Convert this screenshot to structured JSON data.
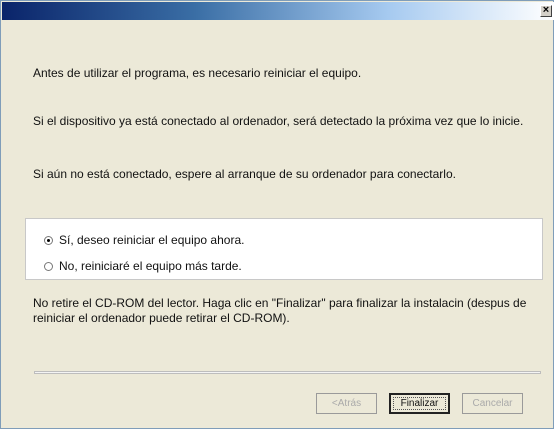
{
  "window": {
    "close_symbol": "×"
  },
  "messages": {
    "intro": "Antes de utilizar el programa, es necesario reiniciar el equipo.",
    "connected": "Si el dispositivo ya está conectado al ordenador, será detectado la próxima vez que lo inicie.",
    "not_connected": "Si aún no está conectado, espere al arranque de su ordenador para conectarlo.",
    "cdrom": "No retire el CD-ROM del lector. Haga clic en \"Finalizar\" para finalizar la instalacin (despus de reiniciar el ordenador puede retirar el CD-ROM)."
  },
  "options": [
    {
      "label": "Sí, deseo reiniciar el equipo ahora.",
      "checked": true
    },
    {
      "label": "No, reiniciaré el equipo más tarde.",
      "checked": false
    }
  ],
  "buttons": {
    "back": "<Atrás",
    "finish": "Finalizar",
    "cancel": "Cancelar"
  }
}
